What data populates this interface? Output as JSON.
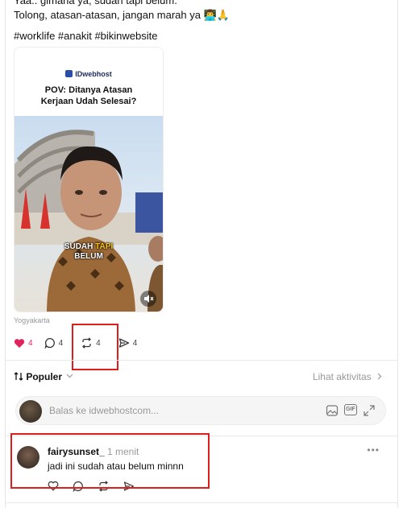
{
  "post": {
    "text_cut": "Yaa.. gimana ya, sudah tapi belum.",
    "text_line": "Tolong, atasan-atasan, jangan marah ya 👨‍💻🙏",
    "hashtags": "#worklife #anakit #bikinwebsite",
    "location": "Yogyakarta"
  },
  "video": {
    "brand": "IDwebhost",
    "title_line1": "POV: Ditanya Atasan",
    "title_line2": "Kerjaan Udah Selesai?",
    "caption_part1": "SUDAH",
    "caption_part2": "TAPI",
    "caption_line2": "BELUM"
  },
  "actions": {
    "likes": "4",
    "comments": "4",
    "reposts": "4",
    "shares": "4"
  },
  "sort": {
    "label": "Populer",
    "activity": "Lihat aktivitas"
  },
  "reply": {
    "placeholder": "Balas ke idwebhostcom..."
  },
  "comment": {
    "username": "fairysunset_",
    "time": "1 menit",
    "text": "jadi ini sudah atau belum minnn"
  },
  "colors": {
    "like": "#e0245e",
    "highlight": "#e01c1c",
    "muted": "#999999"
  }
}
